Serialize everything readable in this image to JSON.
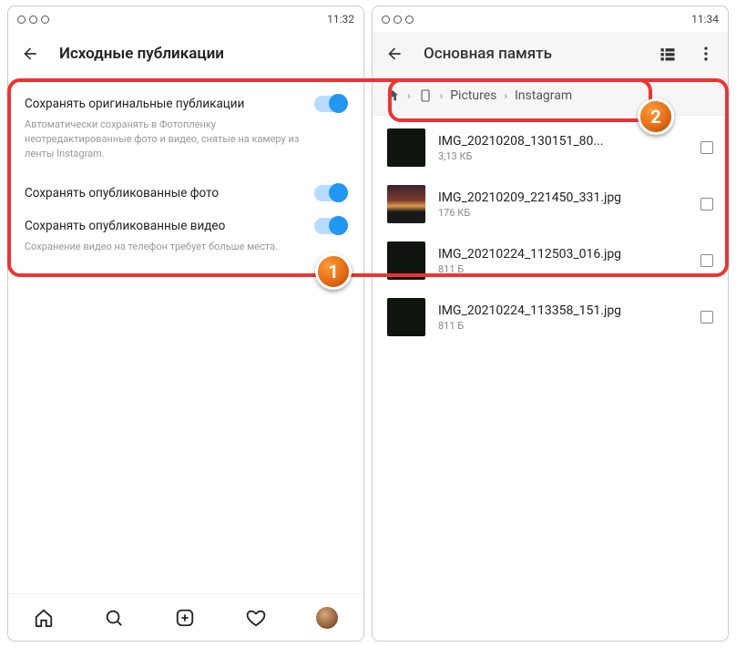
{
  "left": {
    "statusTime": "11:32",
    "title": "Исходные публикации",
    "settings": {
      "row1_label": "Сохранять оригинальные публикации",
      "row1_desc": "Автоматически сохранять в Фотопленку неотредактированные фото и видео, снятые на камеру из ленты Instagram.",
      "row2_label": "Сохранять опубликованные фото",
      "row3_label": "Сохранять опубликованные видео",
      "row3_desc": "Сохранение видео на телефон требует больше места."
    }
  },
  "right": {
    "statusTime": "11:34",
    "title": "Основная память",
    "crumbs": {
      "c1": "Pictures",
      "c2": "Instagram"
    },
    "files": [
      {
        "name": "IMG_20210208_130151_80...",
        "size": "3,13 КБ"
      },
      {
        "name": "IMG_20210209_221450_331.jpg",
        "size": "176 КБ"
      },
      {
        "name": "IMG_20210224_112503_016.jpg",
        "size": "811 Б"
      },
      {
        "name": "IMG_20210224_113358_151.jpg",
        "size": "811 Б"
      }
    ]
  },
  "badges": {
    "b1": "1",
    "b2": "2"
  }
}
